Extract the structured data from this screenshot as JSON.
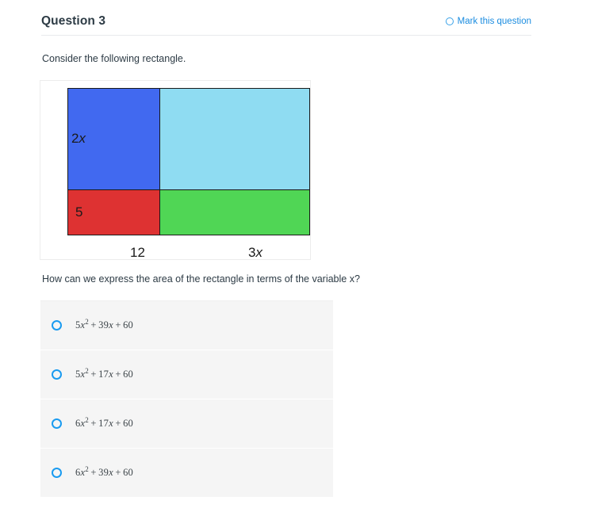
{
  "header": {
    "title": "Question 3",
    "mark_label": "Mark this question",
    "mark_icon": "circle-outline-icon",
    "accent_color": "#1a8ce0"
  },
  "intro_text": "Consider the following rectangle.",
  "diagram": {
    "type": "area-model-rectangle",
    "left_labels": [
      {
        "coefficient": "2",
        "variable": "x"
      },
      {
        "coefficient": "5",
        "variable": ""
      }
    ],
    "bottom_labels": [
      {
        "coefficient": "12",
        "variable": ""
      },
      {
        "coefficient": "3",
        "variable": "x"
      }
    ],
    "cells": [
      {
        "name": "top-left",
        "color": "#4169f0",
        "width_label": "12",
        "height_label": "2x"
      },
      {
        "name": "top-right",
        "color": "#8fdcf2",
        "width_label": "3x",
        "height_label": "2x"
      },
      {
        "name": "bottom-left",
        "color": "#de3232",
        "width_label": "12",
        "height_label": "5"
      },
      {
        "name": "bottom-right",
        "color": "#50d655",
        "width_label": "3x",
        "height_label": "5"
      }
    ],
    "border_color": "#1a1a1a"
  },
  "sub_question": "How can we express the area of the rectangle in terms of the variable x?",
  "options": [
    {
      "id": "a",
      "coef_sq": "5",
      "var1": "x",
      "exp": "2",
      "op1": "+",
      "coef_lin": "39",
      "var2": "x",
      "op2": "+",
      "constant": "60",
      "selected": false
    },
    {
      "id": "b",
      "coef_sq": "5",
      "var1": "x",
      "exp": "2",
      "op1": "+",
      "coef_lin": "17",
      "var2": "x",
      "op2": "+",
      "constant": "60",
      "selected": false
    },
    {
      "id": "c",
      "coef_sq": "6",
      "var1": "x",
      "exp": "2",
      "op1": "+",
      "coef_lin": "17",
      "var2": "x",
      "op2": "+",
      "constant": "60",
      "selected": false
    },
    {
      "id": "d",
      "coef_sq": "6",
      "var1": "x",
      "exp": "2",
      "op1": "+",
      "coef_lin": "39",
      "var2": "x",
      "op2": "+",
      "constant": "60",
      "selected": false
    }
  ]
}
